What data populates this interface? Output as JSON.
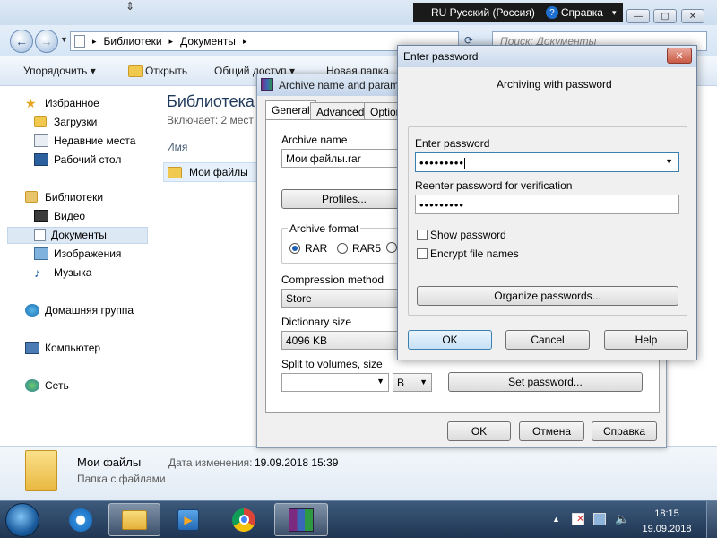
{
  "explorer": {
    "breadcrumb": [
      "Библиотеки",
      "Документы"
    ],
    "search_placeholder": "Поиск: Документы",
    "toolbar": {
      "organize": "Упорядочить",
      "open": "Открыть",
      "share": "Общий доступ",
      "new_folder": "Новая папка"
    },
    "nav": {
      "favorites": "Избранное",
      "downloads": "Загрузки",
      "recent": "Недавние места",
      "desktop": "Рабочий стол",
      "libraries": "Библиотеки",
      "video": "Видео",
      "documents": "Документы",
      "images": "Изображения",
      "music": "Музыка",
      "homegroup": "Домашняя группа",
      "computer": "Компьютер",
      "network": "Сеть"
    },
    "library_title": "Библиотека",
    "library_sub": "Включает: 2 мест",
    "column_name": "Имя",
    "file_name": "Мои файлы",
    "details": {
      "name": "Мои файлы",
      "type": "Папка с файлами",
      "modified_label": "Дата изменения:",
      "modified_value": "19.09.2018 15:39"
    }
  },
  "langbar": {
    "language": "RU Русский (Россия)",
    "help": "Справка"
  },
  "archive_dialog": {
    "title": "Archive name and param",
    "tabs": [
      "General",
      "Advanced",
      "Option"
    ],
    "archive_name_label": "Archive name",
    "archive_name_value": "Мои файлы.rar",
    "profiles_button": "Profiles...",
    "format_label": "Archive format",
    "format_rar": "RAR",
    "format_rar5": "RAR5",
    "compression_label": "Compression method",
    "compression_value": "Store",
    "dictionary_label": "Dictionary size",
    "dictionary_value": "4096 KB",
    "split_label": "Split to volumes, size",
    "split_unit": "B",
    "set_password_button": "Set password...",
    "ok_button": "OK",
    "cancel_button": "Отмена",
    "help_button": "Справка"
  },
  "password_dialog": {
    "title": "Enter password",
    "heading": "Archiving with password",
    "enter_label": "Enter password",
    "enter_value": "•••••••••",
    "reenter_label": "Reenter password for verification",
    "reenter_value": "•••••••••",
    "show_password": "Show password",
    "encrypt_names": "Encrypt file names",
    "organize_button": "Organize passwords...",
    "ok_button": "OK",
    "cancel_button": "Cancel",
    "help_button": "Help"
  },
  "taskbar": {
    "time": "18:15",
    "date": "19.09.2018"
  }
}
